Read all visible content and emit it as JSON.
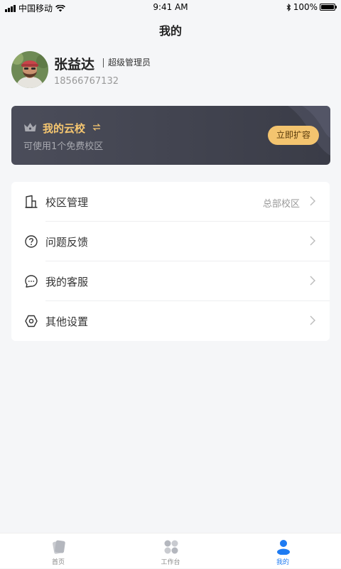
{
  "status_bar": {
    "carrier": "中国移动",
    "time": "9:41 AM",
    "battery": "100%"
  },
  "header": {
    "title": "我的"
  },
  "profile": {
    "name": "张益达",
    "role": "超级管理员",
    "phone": "18566767132"
  },
  "cloud_card": {
    "title": "我的云校",
    "subtitle": "可使用1个免费校区",
    "button_label": "立即扩容",
    "accent_color": "#F3C46F"
  },
  "menu": {
    "items": [
      {
        "label": "校区管理",
        "value": "总部校区",
        "icon": "building-icon"
      },
      {
        "label": "问题反馈",
        "value": "",
        "icon": "question-circle-icon"
      },
      {
        "label": "我的客服",
        "value": "",
        "icon": "chat-bubble-icon"
      },
      {
        "label": "其他设置",
        "value": "",
        "icon": "settings-hexagon-icon"
      }
    ]
  },
  "tabbar": {
    "active_color": "#1E7BF2",
    "tabs": [
      {
        "label": "首页",
        "icon": "home-cards-icon"
      },
      {
        "label": "工作台",
        "icon": "grid-clover-icon"
      },
      {
        "label": "我的",
        "icon": "user-icon"
      }
    ]
  }
}
